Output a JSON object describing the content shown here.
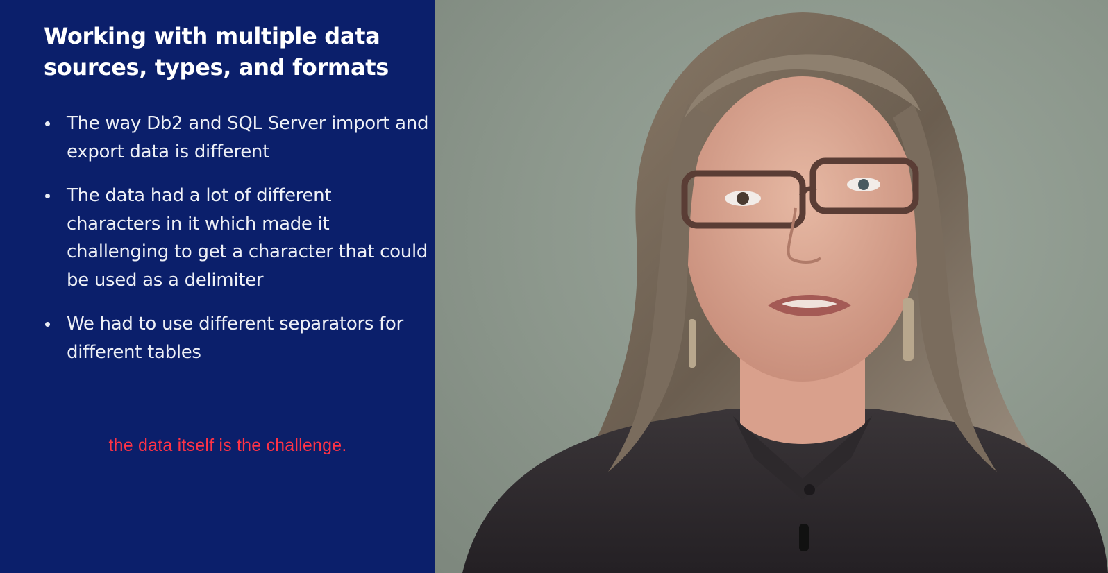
{
  "slide": {
    "title": "Working with multiple data sources, types, and formats",
    "bullets": [
      "The way Db2 and SQL Server import and export data is different",
      "The data had a lot of different characters in it which made it challenging to get a character that could be used as a delimiter",
      "We had to use different separators for different tables"
    ]
  },
  "caption": {
    "text": "the data itself is the challenge."
  },
  "colors": {
    "slide_background": "#0b1f6b",
    "caption_text": "#ff3346",
    "wall": "#8f9a8f"
  }
}
